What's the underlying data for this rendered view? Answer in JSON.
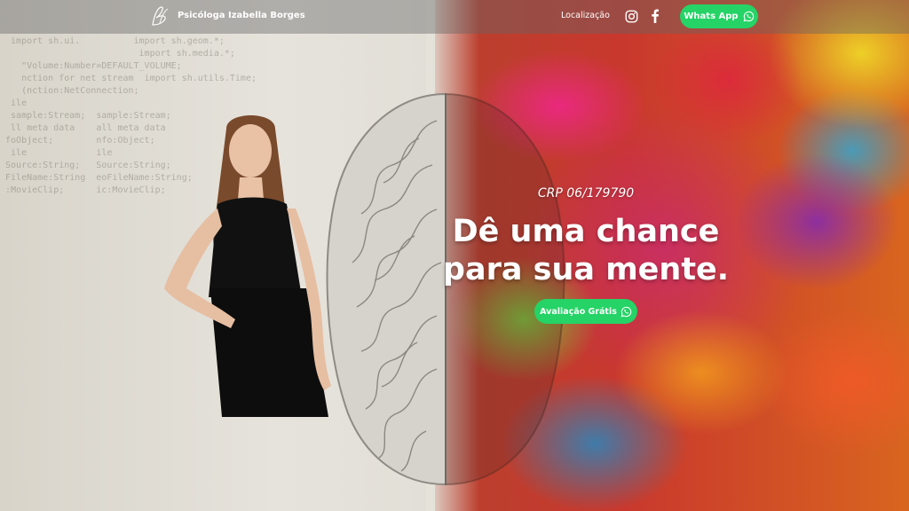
{
  "header": {
    "brand": "Psicóloga Izabella Borges",
    "nav_location": "Localização",
    "whatsapp_label": "Whats App"
  },
  "hero": {
    "crp": "CRP 06/179790",
    "headline_line1": "Dê uma chance",
    "headline_line2": "para sua mente.",
    "cta_label": "Avaliação Grátis"
  },
  "icons": {
    "logo": "logo-monogram-icon",
    "instagram": "instagram-icon",
    "facebook": "facebook-icon",
    "whatsapp": "whatsapp-icon"
  },
  "colors": {
    "accent_green": "#25d366",
    "header_bg": "rgba(100,100,100,0.42)",
    "text_white": "#ffffff"
  }
}
